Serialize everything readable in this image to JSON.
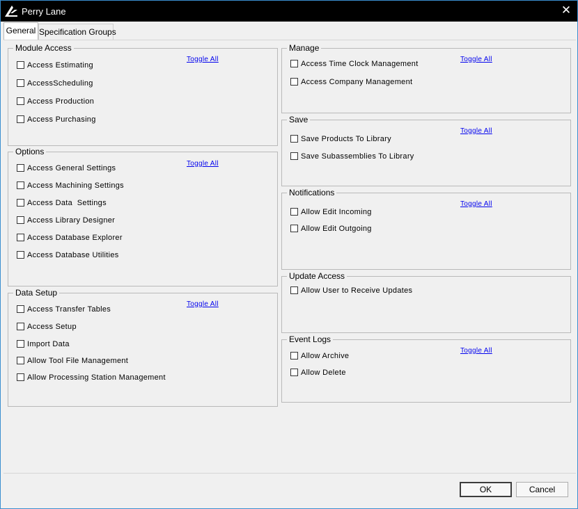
{
  "window": {
    "title": "Perry Lane"
  },
  "tabs": [
    {
      "label": "General"
    },
    {
      "label": "Specification Groups"
    }
  ],
  "toggle_all_label": "Toggle All",
  "groups": {
    "module_access": {
      "title": "Module Access",
      "items": [
        "Access Estimating",
        "AccessScheduling",
        "Access Production",
        "Access Purchasing"
      ]
    },
    "options": {
      "title": "Options",
      "items": [
        "Access General Settings",
        "Access Machining Settings",
        "Access Data  Settings",
        "Access Library Designer",
        "Access Database Explorer",
        "Access Database Utilities"
      ]
    },
    "data_setup": {
      "title": "Data Setup",
      "items": [
        "Access Transfer Tables",
        "Access Setup",
        "Import Data",
        "Allow Tool File Management",
        "Allow Processing Station Management"
      ]
    },
    "manage": {
      "title": "Manage",
      "items": [
        "Access Time Clock Management",
        "Access Company Management"
      ]
    },
    "save": {
      "title": "Save",
      "items": [
        "Save Products To Library",
        "Save Subassemblies To Library"
      ]
    },
    "notifications": {
      "title": "Notifications",
      "items": [
        "Allow Edit Incoming",
        "Allow Edit Outgoing"
      ]
    },
    "update_access": {
      "title": "Update Access",
      "items": [
        "Allow User to Receive Updates"
      ]
    },
    "event_logs": {
      "title": "Event Logs",
      "items": [
        "Allow Archive",
        "Allow Delete"
      ]
    }
  },
  "buttons": {
    "ok": "OK",
    "cancel": "Cancel"
  },
  "icons": {
    "app_logo": "app-logo-icon",
    "close": "close-icon",
    "checkbox": "checkbox-unchecked-icon"
  }
}
